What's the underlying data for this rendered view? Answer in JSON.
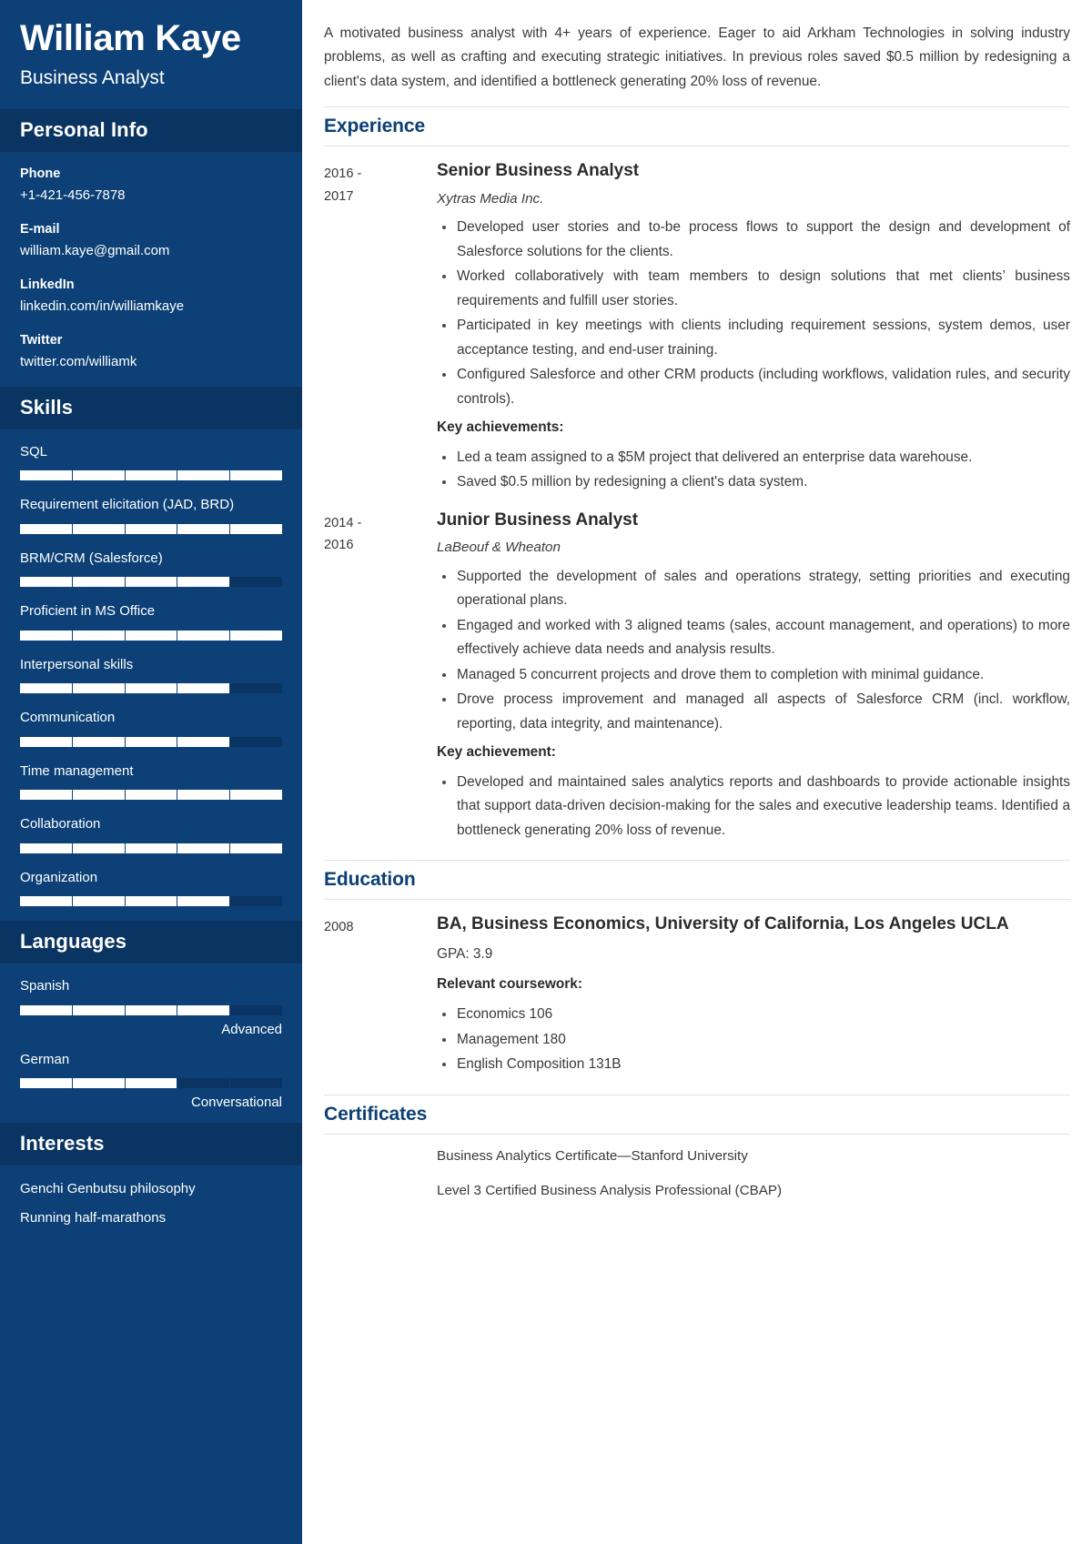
{
  "sidebar": {
    "full_name": "William Kaye",
    "job_title": "Business Analyst",
    "personal_info": {
      "heading": "Personal Info",
      "items": [
        {
          "label": "Phone",
          "value": "+1-421-456-7878"
        },
        {
          "label": "E-mail",
          "value": "william.kaye@gmail.com"
        },
        {
          "label": "LinkedIn",
          "value": "linkedin.com/in/williamkaye"
        },
        {
          "label": "Twitter",
          "value": "twitter.com/williamk"
        }
      ]
    },
    "skills": {
      "heading": "Skills",
      "items": [
        {
          "name": "SQL",
          "level": 100
        },
        {
          "name": "Requirement elicitation (JAD, BRD)",
          "level": 100
        },
        {
          "name": "BRM/CRM (Salesforce)",
          "level": 80
        },
        {
          "name": "Proficient in MS Office",
          "level": 100
        },
        {
          "name": "Interpersonal skills",
          "level": 80
        },
        {
          "name": "Communication",
          "level": 80
        },
        {
          "name": "Time management",
          "level": 100
        },
        {
          "name": "Collaboration",
          "level": 100
        },
        {
          "name": "Organization",
          "level": 80
        }
      ]
    },
    "languages": {
      "heading": "Languages",
      "items": [
        {
          "name": "Spanish",
          "level": 80,
          "proficiency": "Advanced"
        },
        {
          "name": "German",
          "level": 60,
          "proficiency": "Conversational"
        }
      ]
    },
    "interests": {
      "heading": "Interests",
      "items": [
        "Genchi Genbutsu philosophy",
        "Running half-marathons"
      ]
    }
  },
  "main": {
    "summary": "A motivated business analyst with 4+ years of experience. Eager to aid Arkham Technologies in solving industry problems, as well as crafting and executing strategic initiatives. In previous roles saved $0.5 million by redesigning a client's data system, and identified a bottleneck generating 20% loss of revenue.",
    "experience": {
      "heading": "Experience",
      "entries": [
        {
          "date_line1": "2016 -",
          "date_line2": "2017",
          "role": "Senior Business Analyst",
          "org": "Xytras Media Inc.",
          "bullets": [
            "Developed user stories and to-be process flows to support the design and development of Salesforce solutions for the clients.",
            "Worked collaboratively with team members to design solutions that met clients’ business requirements and fulfill user stories.",
            "Participated in key meetings with clients including requirement sessions, system demos, user acceptance testing, and end-user training.",
            "Configured Salesforce and other CRM products (including workflows, validation rules, and security controls)."
          ],
          "achievements_label": "Key achievements:",
          "achievements": [
            "Led a team assigned to a $5M project that delivered an enterprise data warehouse.",
            "Saved $0.5 million by redesigning a client's data system."
          ]
        },
        {
          "date_line1": "2014 -",
          "date_line2": "2016",
          "role": "Junior Business Analyst",
          "org": "LaBeouf & Wheaton",
          "bullets": [
            "Supported the development of sales and operations strategy, setting priorities and executing operational plans.",
            "Engaged and worked with 3 aligned teams (sales, account management, and operations) to more effectively achieve data needs and analysis results.",
            "Managed 5 concurrent projects and drove them to completion with minimal guidance.",
            "Drove process improvement and managed all aspects of Salesforce CRM (incl. workflow, reporting, data integrity, and maintenance)."
          ],
          "achievements_label": "Key achievement:",
          "achievements": [
            "Developed and maintained sales analytics reports and dashboards to provide actionable insights that support data-driven decision-making for the sales and executive leadership teams. Identified a bottleneck generating 20% loss of revenue."
          ]
        }
      ]
    },
    "education": {
      "heading": "Education",
      "entries": [
        {
          "date": "2008",
          "degree": "BA, Business Economics, University of California, Los Angeles UCLA",
          "gpa": "GPA: 3.9",
          "coursework_label": "Relevant coursework:",
          "coursework": [
            "Economics 106",
            "Management 180",
            "English Composition 131B"
          ]
        }
      ]
    },
    "certificates": {
      "heading": "Certificates",
      "items": [
        "Business Analytics Certificate—Stanford University",
        "Level 3 Certified Business Analysis Professional (CBAP)"
      ]
    }
  },
  "theme": {
    "sidebar_bg": "#0c4076",
    "band_bg": "#0a3462",
    "accent": "#0c4076",
    "bar_fill": "#ffffff"
  }
}
